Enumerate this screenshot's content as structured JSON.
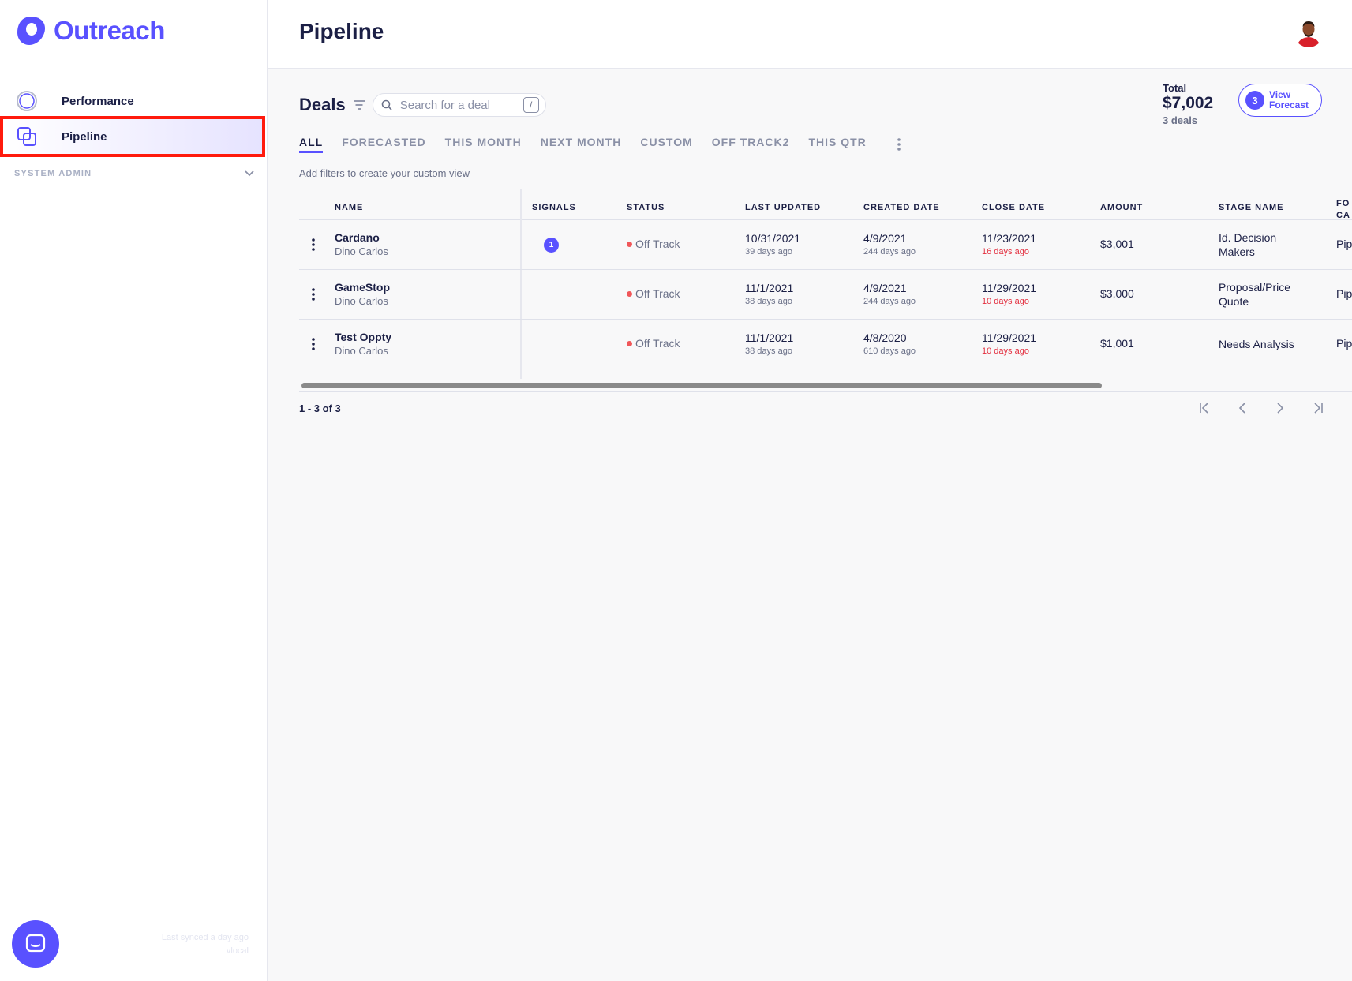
{
  "app": {
    "name": "Outreach"
  },
  "sidebar": {
    "items": [
      {
        "label": "Performance",
        "icon": "circle-icon"
      },
      {
        "label": "Pipeline",
        "icon": "stacked-squares-icon",
        "active": true
      }
    ],
    "section_label": "SYSTEM ADMIN",
    "sync_text_1": "Last synced a day ago",
    "sync_text_2": "vlocal"
  },
  "header": {
    "title": "Pipeline"
  },
  "deals": {
    "title": "Deals",
    "search_placeholder": "Search for a deal",
    "search_shortcut": "/",
    "hint": "Add filters to create your custom view"
  },
  "summary": {
    "total_label": "Total",
    "total_amount": "$7,002",
    "deal_count": "3 deals",
    "forecast_badge": "3",
    "forecast_line1": "View",
    "forecast_line2": "Forecast"
  },
  "tabs": [
    {
      "label": "ALL",
      "active": true
    },
    {
      "label": "FORECASTED"
    },
    {
      "label": "THIS MONTH"
    },
    {
      "label": "NEXT MONTH"
    },
    {
      "label": "CUSTOM"
    },
    {
      "label": "OFF TRACK2"
    },
    {
      "label": "THIS QTR"
    }
  ],
  "table": {
    "columns": {
      "name": "NAME",
      "signals": "SIGNALS",
      "status": "STATUS",
      "last_updated": "LAST UPDATED",
      "created_date": "CREATED DATE",
      "close_date": "CLOSE DATE",
      "amount": "AMOUNT",
      "stage_name": "STAGE NAME",
      "fo_line1": "FO",
      "fo_line2": "CA"
    },
    "rows": [
      {
        "name": "Cardano",
        "owner": "Dino Carlos",
        "signals": "1",
        "status": "Off Track",
        "last_updated": "10/31/2021",
        "last_updated_ago": "39 days ago",
        "created": "4/9/2021",
        "created_ago": "244 days ago",
        "close": "11/23/2021",
        "close_ago": "16 days ago",
        "amount": "$3,001",
        "stage": "Id. Decision Makers",
        "fc": "Pip"
      },
      {
        "name": "GameStop",
        "owner": "Dino Carlos",
        "signals": "",
        "status": "Off Track",
        "last_updated": "11/1/2021",
        "last_updated_ago": "38 days ago",
        "created": "4/9/2021",
        "created_ago": "244 days ago",
        "close": "11/29/2021",
        "close_ago": "10 days ago",
        "amount": "$3,000",
        "stage": "Proposal/Price Quote",
        "fc": "Pip"
      },
      {
        "name": "Test Oppty",
        "owner": "Dino Carlos",
        "signals": "",
        "status": "Off Track",
        "last_updated": "11/1/2021",
        "last_updated_ago": "38 days ago",
        "created": "4/8/2020",
        "created_ago": "610 days ago",
        "close": "11/29/2021",
        "close_ago": "10 days ago",
        "amount": "$1,001",
        "stage": "Needs Analysis",
        "fc": "Pip"
      }
    ]
  },
  "pagination": {
    "range_text": "1 - 3 of 3"
  },
  "colors": {
    "brand": "#5951ff",
    "text": "#1b1f45",
    "muted": "#6a7088",
    "danger": "#e33040",
    "highlight": "#ff1a0d"
  }
}
